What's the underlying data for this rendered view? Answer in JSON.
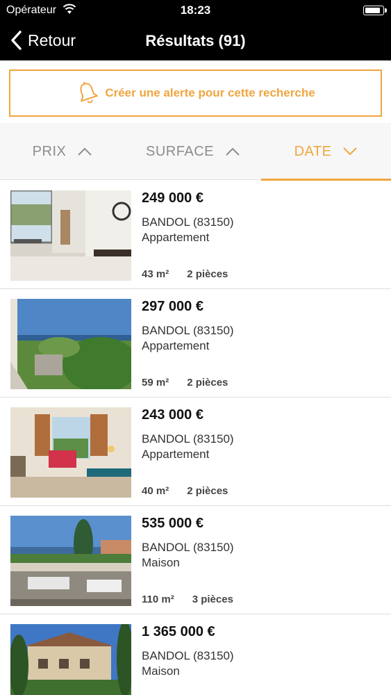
{
  "status": {
    "carrier": "Opérateur",
    "time": "18:23",
    "battery_level": 0.92
  },
  "nav": {
    "back_label": "Retour",
    "title": "Résultats (91)"
  },
  "alert": {
    "label": "Créer une alerte pour cette recherche",
    "icon": "bell-icon"
  },
  "sort": [
    {
      "label": "PRIX",
      "direction": "up",
      "active": false
    },
    {
      "label": "SURFACE",
      "direction": "up",
      "active": false
    },
    {
      "label": "DATE",
      "direction": "down",
      "active": true
    }
  ],
  "colors": {
    "accent": "#f0a53f",
    "bar": "#000000"
  },
  "listings": [
    {
      "price": "249 000 €",
      "city": "BANDOL (83150)",
      "type": "Appartement",
      "surface": "43 m²",
      "rooms": "2 pièces"
    },
    {
      "price": "297 000 €",
      "city": "BANDOL (83150)",
      "type": "Appartement",
      "surface": "59 m²",
      "rooms": "2 pièces"
    },
    {
      "price": "243 000 €",
      "city": "BANDOL (83150)",
      "type": "Appartement",
      "surface": "40 m²",
      "rooms": "2 pièces"
    },
    {
      "price": "535 000 €",
      "city": "BANDOL (83150)",
      "type": "Maison",
      "surface": "110 m²",
      "rooms": "3 pièces"
    },
    {
      "price": "1 365 000 €",
      "city": "BANDOL (83150)",
      "type": "Maison",
      "surface": "",
      "rooms": ""
    }
  ]
}
